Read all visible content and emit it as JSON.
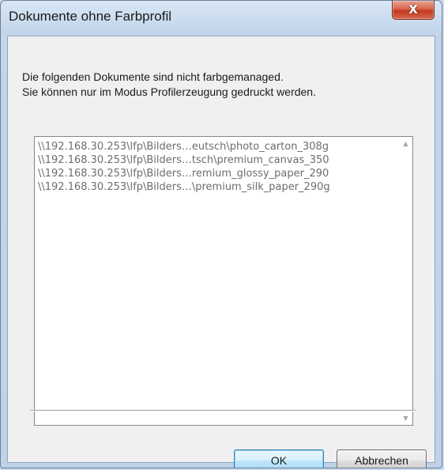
{
  "window": {
    "title": "Dokumente ohne Farbprofil",
    "close_label": "X"
  },
  "message": {
    "line1": "Die folgenden Dokumente sind nicht farbgemanaged.",
    "line2": "Sie können nur im Modus Profilerzeugung gedruckt werden."
  },
  "documents": {
    "items": [
      "\\\\192.168.30.253\\lfp\\Bilders…eutsch\\photo_carton_308g",
      "\\\\192.168.30.253\\lfp\\Bilders…tsch\\premium_canvas_350",
      "\\\\192.168.30.253\\lfp\\Bilders…remium_glossy_paper_290",
      "\\\\192.168.30.253\\lfp\\Bilders…\\premium_silk_paper_290g"
    ],
    "scroll_up_icon": "▲",
    "scroll_down_icon": "▼"
  },
  "buttons": {
    "ok_label": "OK",
    "cancel_label": "Abbrechen"
  },
  "colors": {
    "close_button": "#c2381f",
    "default_button_border": "#3c7fb1",
    "list_text": "#6d6d6d"
  }
}
